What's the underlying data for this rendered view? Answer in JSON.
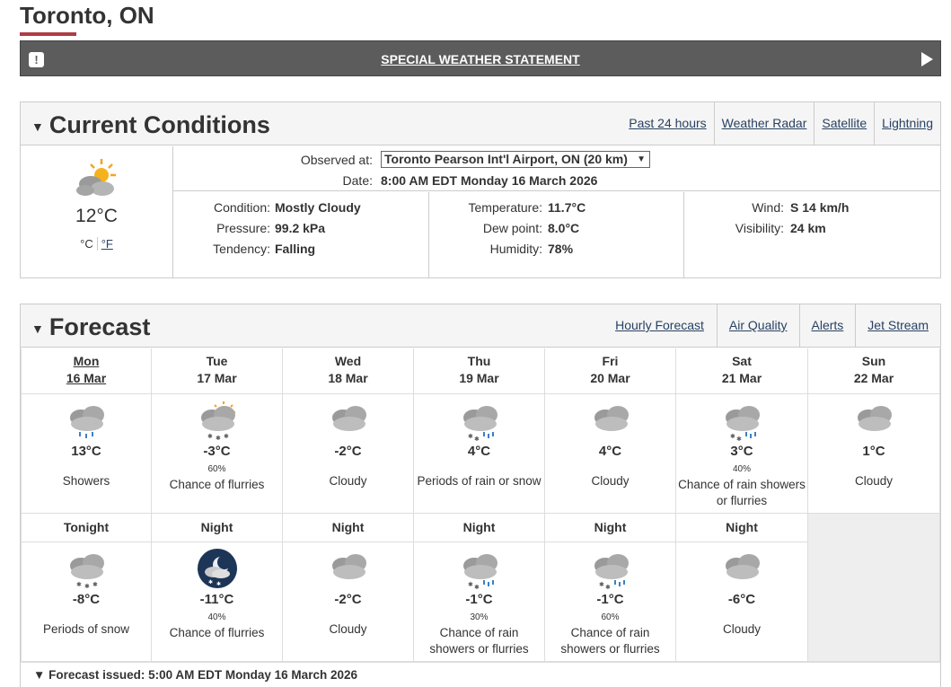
{
  "location": {
    "title": "Toronto, ON"
  },
  "alert": {
    "label": "SPECIAL WEATHER STATEMENT",
    "bang": "!"
  },
  "current": {
    "section_title": "Current Conditions",
    "links": [
      "Past 24 hours",
      "Weather Radar",
      "Satellite",
      "Lightning"
    ],
    "icon": "mostly-cloudy-icon",
    "temperature": "12°C",
    "unit_c": "°C",
    "unit_f": "°F",
    "observed_label": "Observed at:",
    "station": "Toronto Pearson Int'l Airport, ON (20 km)",
    "date_label": "Date:",
    "date_value": "8:00 AM EDT Monday 16 March 2026",
    "col1": [
      {
        "label": "Condition:",
        "value": "Mostly Cloudy"
      },
      {
        "label": "Pressure:",
        "value": "99.2 kPa"
      },
      {
        "label": "Tendency:",
        "value": "Falling"
      }
    ],
    "col2": [
      {
        "label": "Temperature:",
        "value": "11.7°C"
      },
      {
        "label": "Dew point:",
        "value": "8.0°C"
      },
      {
        "label": "Humidity:",
        "value": "78%"
      }
    ],
    "col3": [
      {
        "label": "Wind:",
        "value": "S 14 km/h"
      },
      {
        "label": "Visibility:",
        "value": "24 km"
      }
    ]
  },
  "forecast": {
    "section_title": "Forecast",
    "links": [
      "Hourly Forecast",
      "Air Quality",
      "Alerts",
      "Jet Stream"
    ],
    "days": [
      {
        "name": "Mon",
        "date": "16 Mar",
        "temp": "13°C",
        "pop": "",
        "summary": "Showers",
        "icon": "showers-icon"
      },
      {
        "name": "Tue",
        "date": "17 Mar",
        "temp": "-3°C",
        "pop": "60%",
        "summary": "Chance of flurries",
        "icon": "sun-cloud-flurries-icon"
      },
      {
        "name": "Wed",
        "date": "18 Mar",
        "temp": "-2°C",
        "pop": "",
        "summary": "Cloudy",
        "icon": "cloudy-icon"
      },
      {
        "name": "Thu",
        "date": "19 Mar",
        "temp": "4°C",
        "pop": "",
        "summary": "Periods of rain or snow",
        "icon": "rain-snow-icon"
      },
      {
        "name": "Fri",
        "date": "20 Mar",
        "temp": "4°C",
        "pop": "",
        "summary": "Cloudy",
        "icon": "cloudy-icon"
      },
      {
        "name": "Sat",
        "date": "21 Mar",
        "temp": "3°C",
        "pop": "40%",
        "summary": "Chance of rain showers or flurries",
        "icon": "rain-snow-icon"
      },
      {
        "name": "Sun",
        "date": "22 Mar",
        "temp": "1°C",
        "pop": "",
        "summary": "Cloudy",
        "icon": "cloudy-icon"
      }
    ],
    "nights": [
      {
        "name": "Tonight",
        "temp": "-8°C",
        "pop": "",
        "summary": "Periods of snow",
        "icon": "snow-icon"
      },
      {
        "name": "Night",
        "temp": "-11°C",
        "pop": "40%",
        "summary": "Chance of flurries",
        "icon": "night-moon-flurries-icon"
      },
      {
        "name": "Night",
        "temp": "-2°C",
        "pop": "",
        "summary": "Cloudy",
        "icon": "cloudy-icon"
      },
      {
        "name": "Night",
        "temp": "-1°C",
        "pop": "30%",
        "summary": "Chance of rain showers or flurries",
        "icon": "rain-snow-icon"
      },
      {
        "name": "Night",
        "temp": "-1°C",
        "pop": "60%",
        "summary": "Chance of rain showers or flurries",
        "icon": "rain-snow-icon"
      },
      {
        "name": "Night",
        "temp": "-6°C",
        "pop": "",
        "summary": "Cloudy",
        "icon": "cloudy-icon"
      }
    ],
    "issued": "▼ Forecast issued: 5:00 AM EDT Monday 16 March 2026"
  },
  "colors": {
    "accent": "#af3c43",
    "alert_bg": "#5c5c5c",
    "link": "#284162"
  }
}
